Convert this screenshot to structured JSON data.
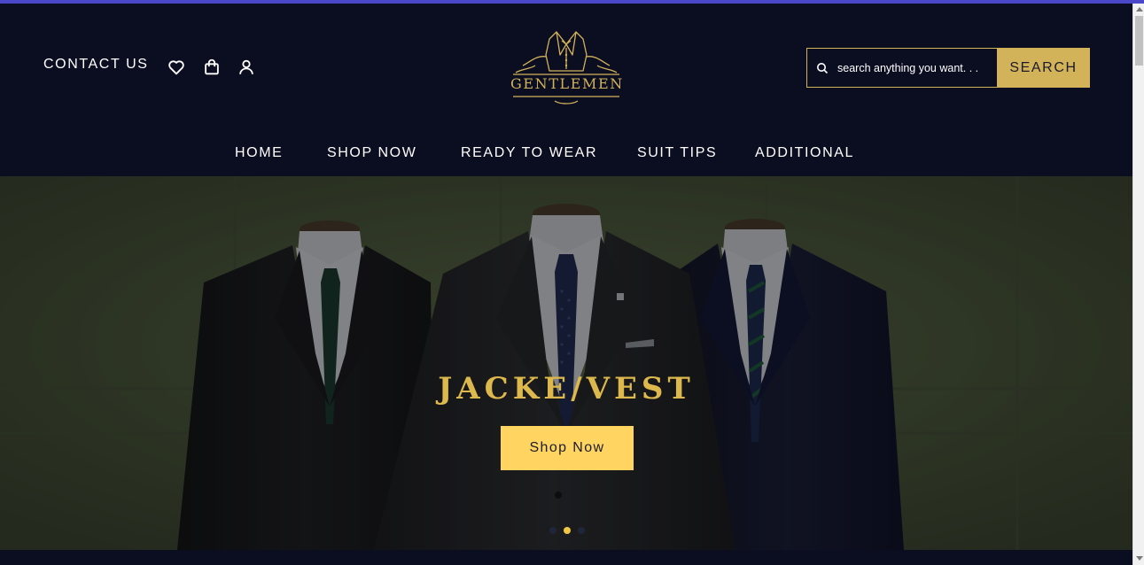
{
  "header": {
    "contact_label": "CONTACT US",
    "icons": [
      "heart-icon",
      "shopping-bag-icon",
      "user-icon"
    ],
    "logo_text": "GENTLEMEN",
    "search": {
      "placeholder": "search anything you want. . .",
      "value": "",
      "button_label": "SEARCH"
    }
  },
  "nav": {
    "items": [
      {
        "label": "HOME"
      },
      {
        "label": "SHOP NOW"
      },
      {
        "label": "READY TO WEAR"
      },
      {
        "label": "SUIT TIPS"
      },
      {
        "label": "ADDITIONAL"
      }
    ]
  },
  "hero": {
    "title": "JACKE/VEST",
    "button_label": "Shop Now",
    "slide_count": 3,
    "active_slide": 2
  },
  "colors": {
    "header_bg": "#0b0d21",
    "gold": "#d3b35a",
    "hero_button": "#ffd460",
    "hero_title": "#ddb84c",
    "top_line": "#4a48c8"
  }
}
